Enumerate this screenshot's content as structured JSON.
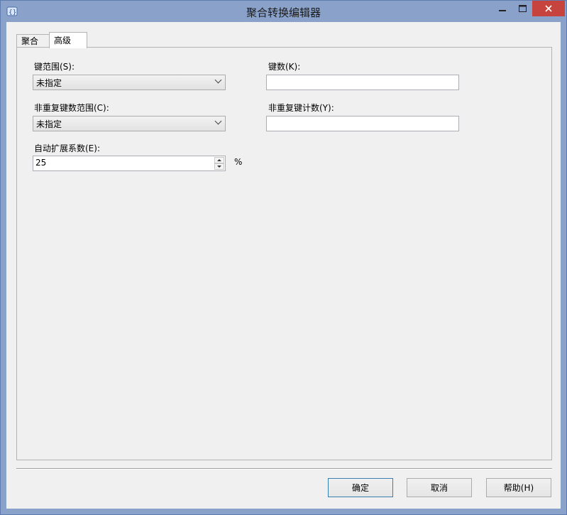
{
  "window": {
    "title": "聚合转换编辑器",
    "icon": "aggregate-transform-icon"
  },
  "tabs": [
    {
      "label": "聚合"
    },
    {
      "label": "高级"
    }
  ],
  "selected_tab": "高级",
  "advanced": {
    "key_scope_label": "键范围(S):",
    "key_scope_value": "未指定",
    "keys_label": "键数(K):",
    "keys_value": "",
    "distinct_key_scope_label": "非重复键数范围(C):",
    "distinct_key_scope_value": "未指定",
    "distinct_key_count_label": "非重复键计数(Y):",
    "distinct_key_count_value": "",
    "auto_extend_label": "自动扩展系数(E):",
    "auto_extend_value": "25",
    "percent_sign": "%"
  },
  "buttons": {
    "ok": "确定",
    "cancel": "取消",
    "help": "帮助(H)"
  }
}
